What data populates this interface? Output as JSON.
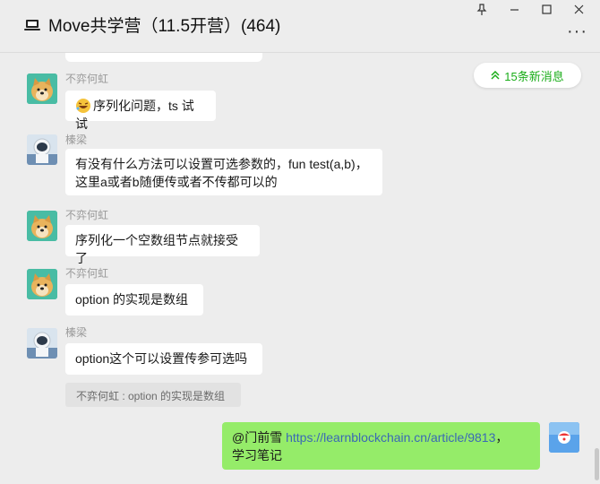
{
  "window": {
    "title": "Move共学营（11.5开营）(464)",
    "controls": [
      "pin-icon",
      "minimize-icon",
      "maximize-icon",
      "close-icon"
    ],
    "more_label": "···"
  },
  "new_messages": {
    "label": "15条新消息",
    "icon": "double-chevron-up-icon"
  },
  "messages": [
    {
      "sender": "不弈何虹",
      "avatar": "doge",
      "text": "序列化问题，ts 试试",
      "has_emoji": true
    },
    {
      "sender": "榛梁",
      "avatar": "astronaut",
      "line1": "有没有什么方法可以设置可选参数的，fun test(a,b)，",
      "line2": "这里a或者b随便传或者不传都可以的"
    },
    {
      "sender": "不弈何虹",
      "avatar": "doge",
      "text": "序列化一个空数组节点就接受了"
    },
    {
      "sender": "不弈何虹",
      "avatar": "doge",
      "text": "option 的实现是数组"
    },
    {
      "sender": "榛梁",
      "avatar": "astronaut",
      "text": "option这个可以设置传参可选吗",
      "quote": "不弈何虹 : option 的实现是数组"
    }
  ],
  "my_message": {
    "mention": "@门前雪",
    "link": "https://learnblockchain.cn/article/9813",
    "suffix": "，",
    "line2": "学习笔记"
  },
  "colors": {
    "my_bubble": "#95ec69",
    "accent_green": "#1aad19",
    "link": "#3a69b5"
  }
}
